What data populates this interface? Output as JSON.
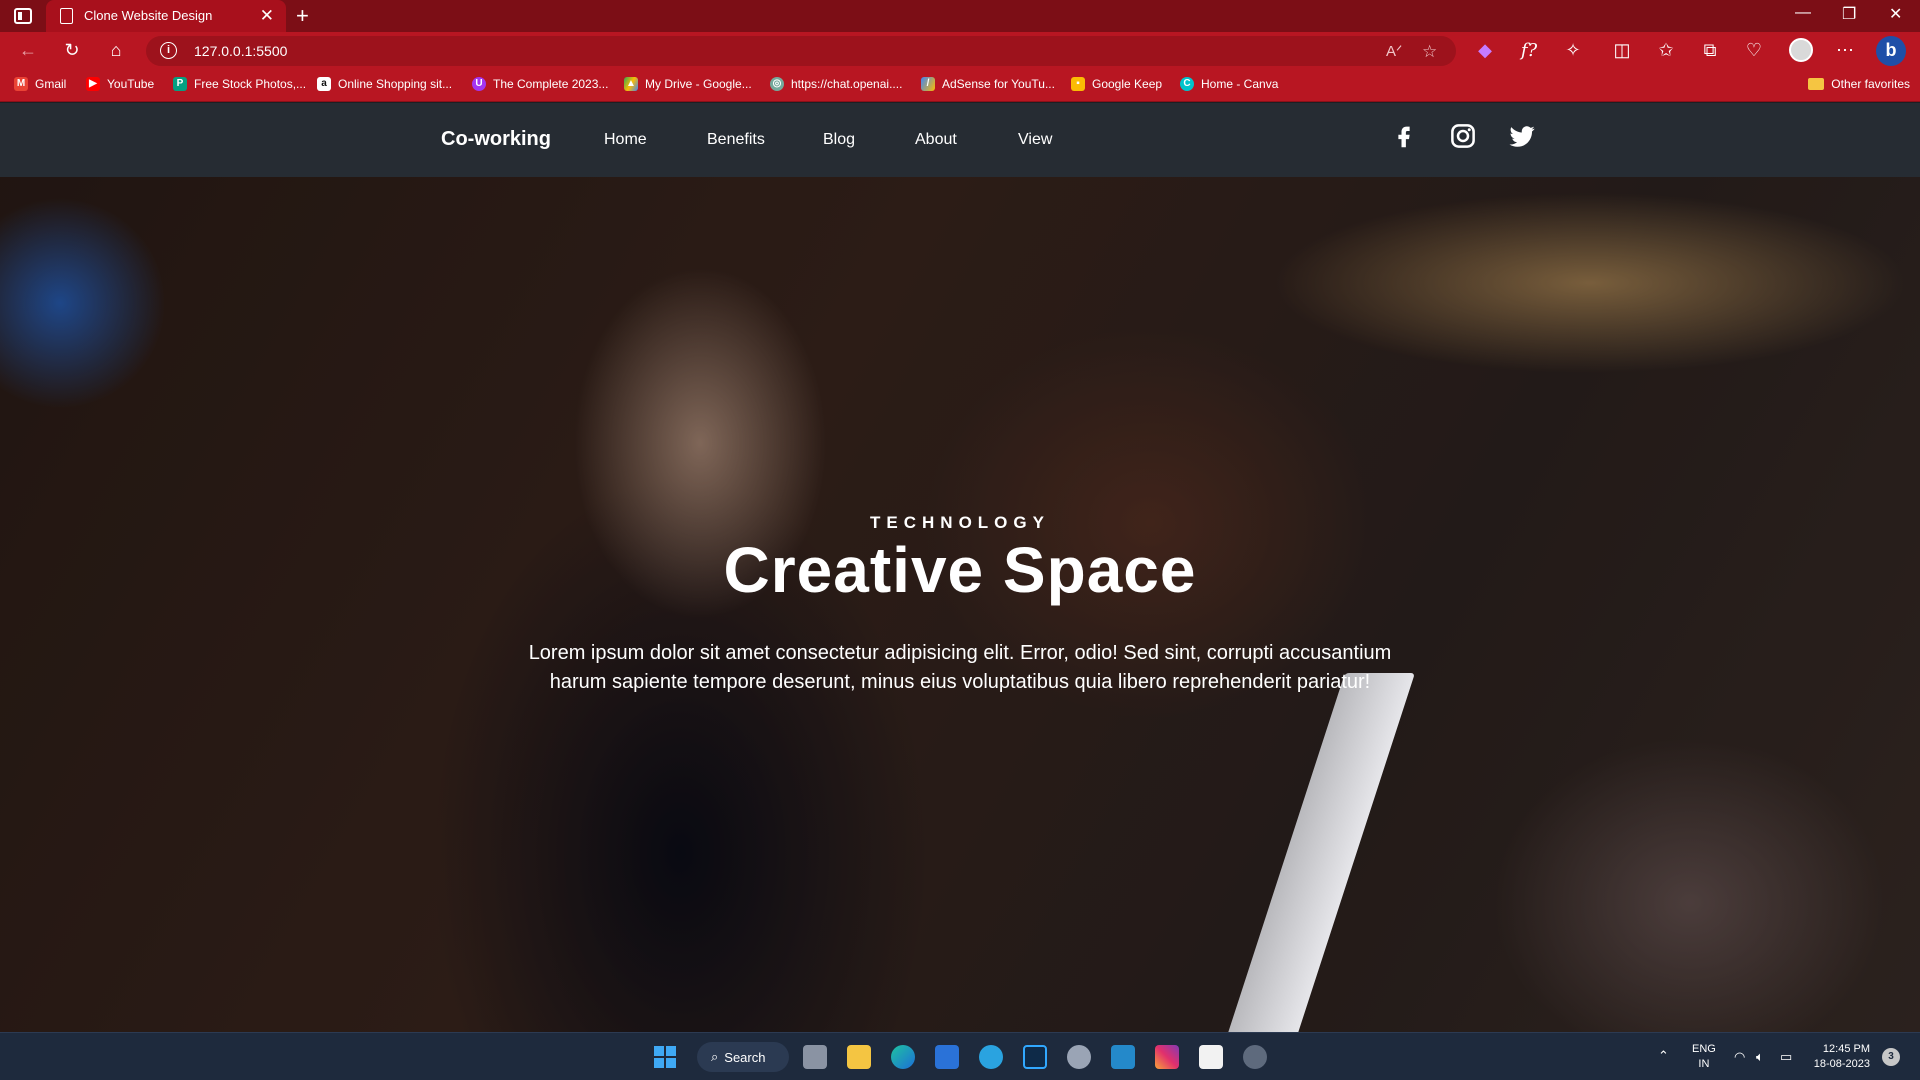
{
  "browser": {
    "tab_title": "Clone Website Design",
    "url": "127.0.0.1:5500",
    "bookmarks": [
      {
        "label": "Gmail",
        "icon": "gmail-icon",
        "color": "#ea4335"
      },
      {
        "label": "YouTube",
        "icon": "youtube-icon",
        "color": "#ff0000"
      },
      {
        "label": "Free Stock Photos,...",
        "icon": "pexels-icon",
        "color": "#05a081"
      },
      {
        "label": "Online Shopping sit...",
        "icon": "amazon-icon",
        "color": "#ffffff"
      },
      {
        "label": "The Complete 2023...",
        "icon": "udemy-icon",
        "color": "#a435f0"
      },
      {
        "label": "My Drive - Google...",
        "icon": "google-drive-icon",
        "color": "#34a853"
      },
      {
        "label": "https://chat.openai....",
        "icon": "openai-icon",
        "color": "#74aa9c"
      },
      {
        "label": "AdSense for YouTu...",
        "icon": "adsense-icon",
        "color": "#fbbc04"
      },
      {
        "label": "Google Keep",
        "icon": "google-keep-icon",
        "color": "#fbbc04"
      },
      {
        "label": "Home - Canva",
        "icon": "canva-icon",
        "color": "#00c4cc"
      }
    ],
    "other_favorites": "Other favorites"
  },
  "site": {
    "brand": "Co-working",
    "nav": [
      "Home",
      "Benefits",
      "Blog",
      "About",
      "View"
    ],
    "social": [
      "facebook-icon",
      "instagram-icon",
      "twitter-icon"
    ]
  },
  "hero": {
    "eyebrow": "TECHNOLOGY",
    "title": "Creative Space",
    "body": "Lorem ipsum dolor sit amet consectetur adipisicing elit. Error, odio! Sed sint, corrupti accusantium harum sapiente tempore deserunt, minus eius voluptatibus quia libero reprehenderit pariatur!"
  },
  "taskbar": {
    "search_label": "Search",
    "lang_line1": "ENG",
    "lang_line2": "IN",
    "time": "12:45 PM",
    "date": "18-08-2023",
    "notifications": "3"
  },
  "colors": {
    "tab_strip": "#7c0e16",
    "toolbar": "#b81622",
    "navbar": "#262c33",
    "taskbar": "#1e2a3d"
  }
}
